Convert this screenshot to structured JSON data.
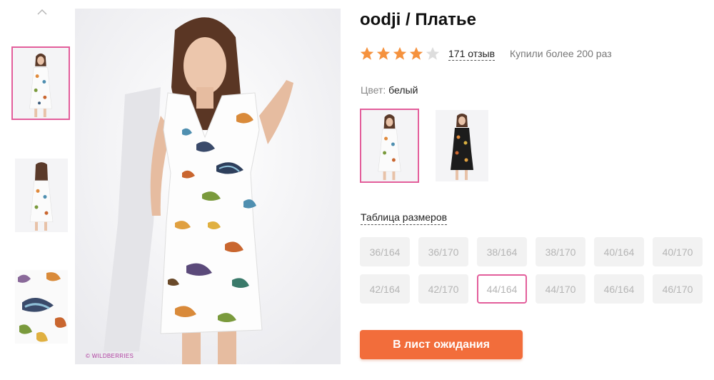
{
  "product": {
    "title": "oodji / Платье",
    "rating": 4,
    "rating_max": 5,
    "reviews_label": "171 отзыв",
    "bought_label": "Купили более 200 раз"
  },
  "gallery": {
    "watermark": "© WILDBERRIES",
    "thumbnails": [
      "front-view",
      "back-view",
      "fabric-closeup"
    ],
    "active_index": 0
  },
  "color": {
    "label": "Цвет:",
    "value": "белый",
    "options": [
      "white-print",
      "black-print"
    ],
    "selected_index": 0
  },
  "sizes": {
    "table_link": "Таблица размеров",
    "options": [
      "36/164",
      "36/170",
      "38/164",
      "38/170",
      "40/164",
      "40/170",
      "42/164",
      "42/170",
      "44/164",
      "44/170",
      "46/164",
      "46/170"
    ],
    "selected": "44/164"
  },
  "action": {
    "waitlist_label": "В лист ожидания"
  },
  "colors": {
    "accent": "#e35e9b",
    "cta": "#f26d3b",
    "star": "#f5923e",
    "star_empty": "#dddddd"
  }
}
